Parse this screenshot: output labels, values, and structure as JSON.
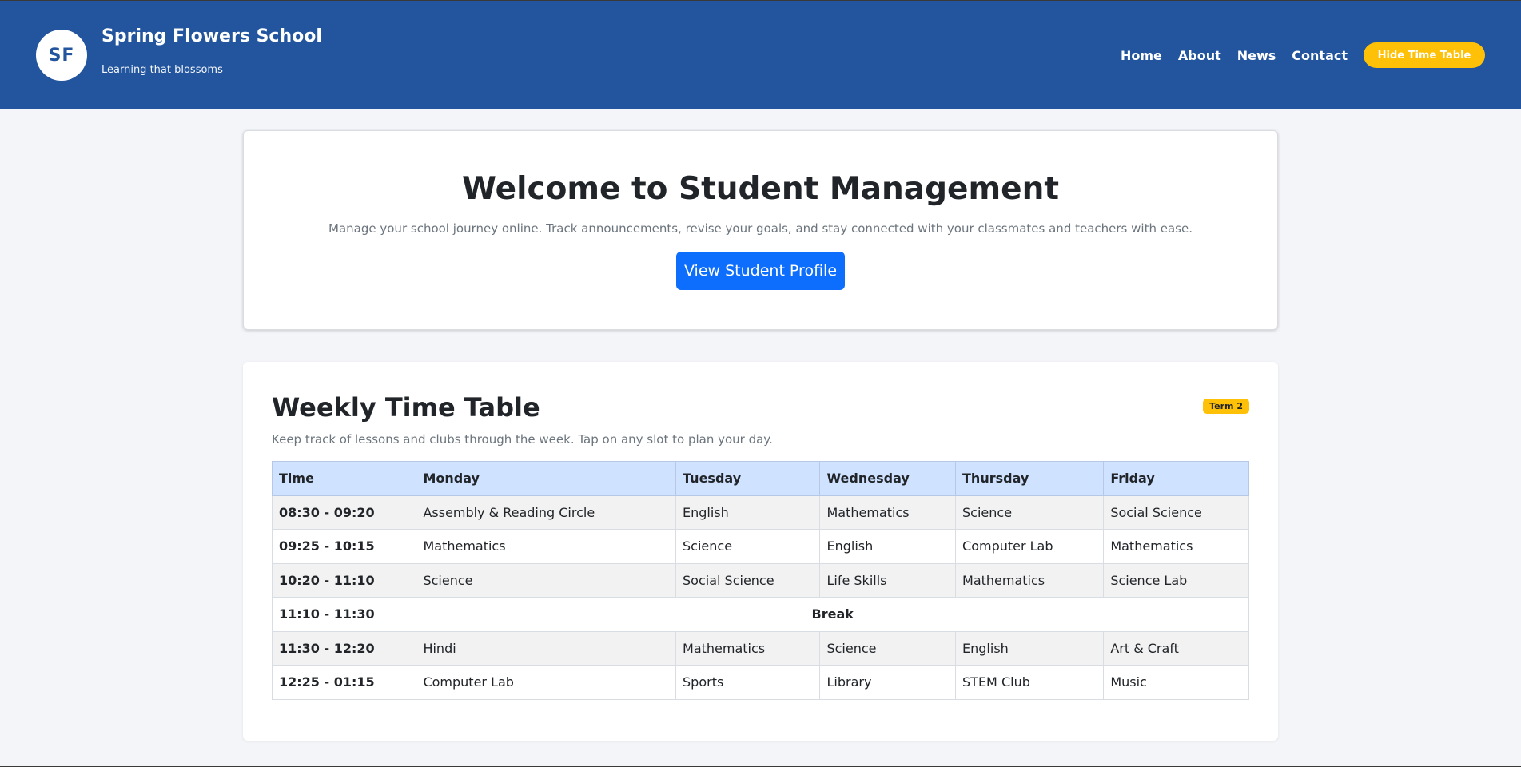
{
  "header": {
    "logo_initials": "SF",
    "school_name": "Spring Flowers School",
    "tagline": "Learning that blossoms",
    "nav": [
      "Home",
      "About",
      "News",
      "Contact"
    ],
    "toggle_label": "Hide Time Table"
  },
  "hero": {
    "title": "Welcome to Student Management",
    "description": "Manage your school journey online. Track announcements, revise your goals, and stay connected with your classmates and teachers with ease.",
    "button_label": "View Student Profile"
  },
  "timetable": {
    "title": "Weekly Time Table",
    "badge": "Term 2",
    "subtitle": "Keep track of lessons and clubs through the week. Tap on any slot to plan your day.",
    "columns": [
      "Time",
      "Monday",
      "Tuesday",
      "Wednesday",
      "Thursday",
      "Friday"
    ],
    "rows": [
      {
        "time": "08:30 - 09:20",
        "cells": [
          "Assembly & Reading Circle",
          "English",
          "Mathematics",
          "Science",
          "Social Science"
        ]
      },
      {
        "time": "09:25 - 10:15",
        "cells": [
          "Mathematics",
          "Science",
          "English",
          "Computer Lab",
          "Mathematics"
        ]
      },
      {
        "time": "10:20 - 11:10",
        "cells": [
          "Science",
          "Social Science",
          "Life Skills",
          "Mathematics",
          "Science Lab"
        ]
      },
      {
        "time": "11:10 - 11:30",
        "break": "Break"
      },
      {
        "time": "11:30 - 12:20",
        "cells": [
          "Hindi",
          "Mathematics",
          "Science",
          "English",
          "Art & Craft"
        ]
      },
      {
        "time": "12:25 - 01:15",
        "cells": [
          "Computer Lab",
          "Sports",
          "Library",
          "STEM Club",
          "Music"
        ]
      }
    ]
  },
  "colors": {
    "header_bg": "#22559e",
    "accent_yellow": "#ffc107",
    "primary_blue": "#0d6efd",
    "table_header_bg": "#cfe2ff"
  }
}
